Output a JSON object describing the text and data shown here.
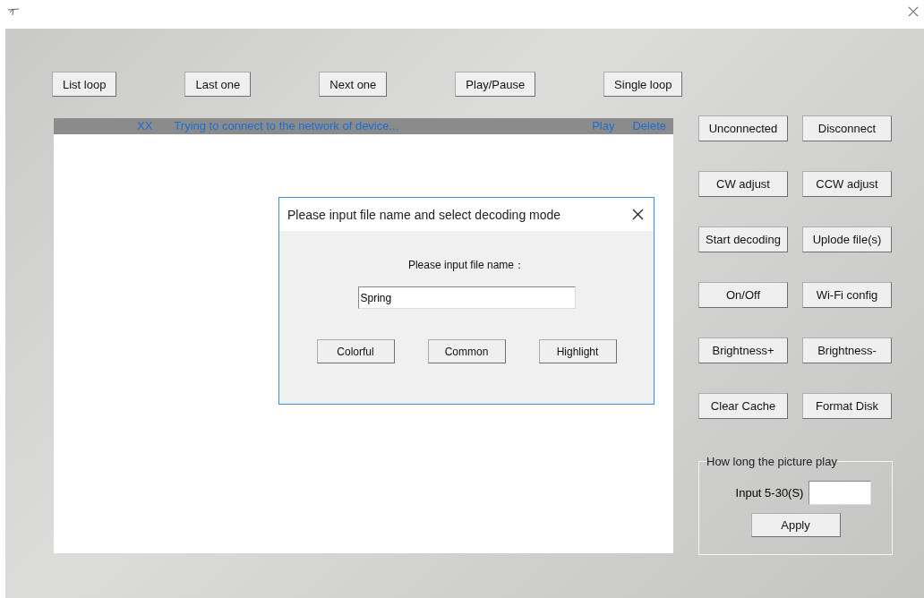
{
  "top_buttons": [
    "List loop",
    "Last one",
    "Next one",
    "Play/Pause",
    "Single loop"
  ],
  "file_list": {
    "header": {
      "column_1": "XX",
      "status": "Trying to connect to the network of device...",
      "play": "Play",
      "delete": "Delete"
    }
  },
  "side_buttons": [
    "Unconnected",
    "Disconnect",
    "CW adjust",
    "CCW adjust",
    "Start decoding",
    "Uplode file(s)",
    "On/Off",
    "Wi-Fi config",
    "Brightness+",
    "Brightness-",
    "Clear Cache",
    "Format Disk"
  ],
  "play_duration": {
    "title": "How long the picture play",
    "label": "Input 5-30(S)",
    "apply": "Apply"
  },
  "dialog": {
    "title": "Please input file name and select decoding mode",
    "prompt": "Please input file name：",
    "file_name": "Spring",
    "buttons": [
      "Colorful",
      "Common",
      "Highlight"
    ]
  }
}
